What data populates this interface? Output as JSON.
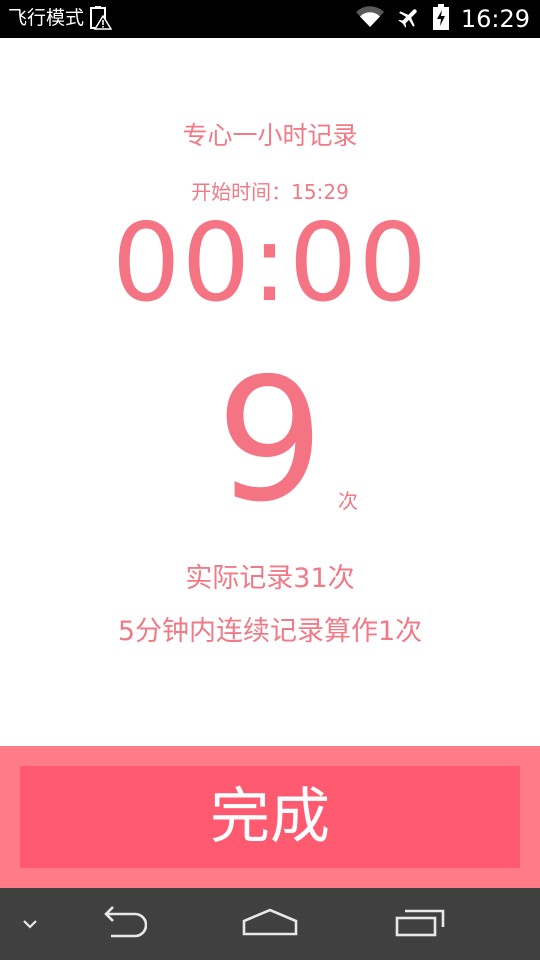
{
  "status_bar": {
    "mode_text": "飞行模式",
    "time": "16:29",
    "icons": [
      "warning-icon",
      "wifi-icon",
      "airplane-icon",
      "battery-icon"
    ]
  },
  "record": {
    "title": "专心一小时记录",
    "start_label": "开始时间：",
    "start_time": "15:29",
    "timer": "00:00",
    "count": "9",
    "count_unit": "次",
    "actual_text": "实际记录31次",
    "note_text": "5分钟内连续记录算作1次"
  },
  "action": {
    "done_label": "完成"
  },
  "nav_bar": {
    "icons": [
      "chevron-down-icon",
      "back-icon",
      "home-icon",
      "recents-icon"
    ]
  },
  "colors": {
    "accent_text": "#f07a86",
    "accent_large": "#f57483",
    "button": "#ff5a70",
    "button_area": "#ff7b86",
    "status_bar": "#000000",
    "nav_bar": "#404040"
  }
}
